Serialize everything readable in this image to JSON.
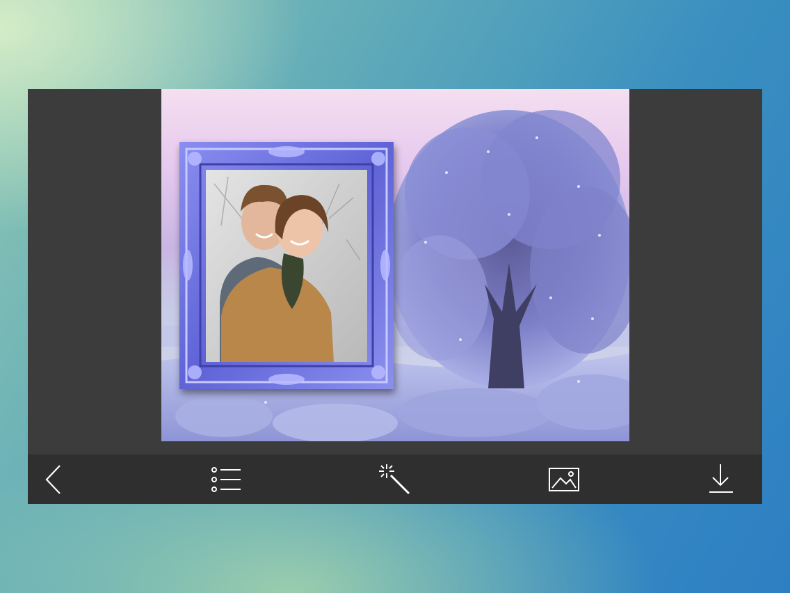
{
  "app": {
    "screen": "photo-frame-editor"
  },
  "canvas": {
    "background_scene": "frosted-tree-winter",
    "frame_color": "#6a6ed8",
    "photo_subject": "couple-portrait"
  },
  "toolbar": {
    "buttons": [
      {
        "icon": "back-chevron-icon"
      },
      {
        "icon": "frame-list-icon"
      },
      {
        "icon": "magic-wand-icon"
      },
      {
        "icon": "image-gallery-icon"
      },
      {
        "icon": "download-icon"
      }
    ],
    "icon_color": "#ffffff",
    "background": "#2f2f2f"
  }
}
